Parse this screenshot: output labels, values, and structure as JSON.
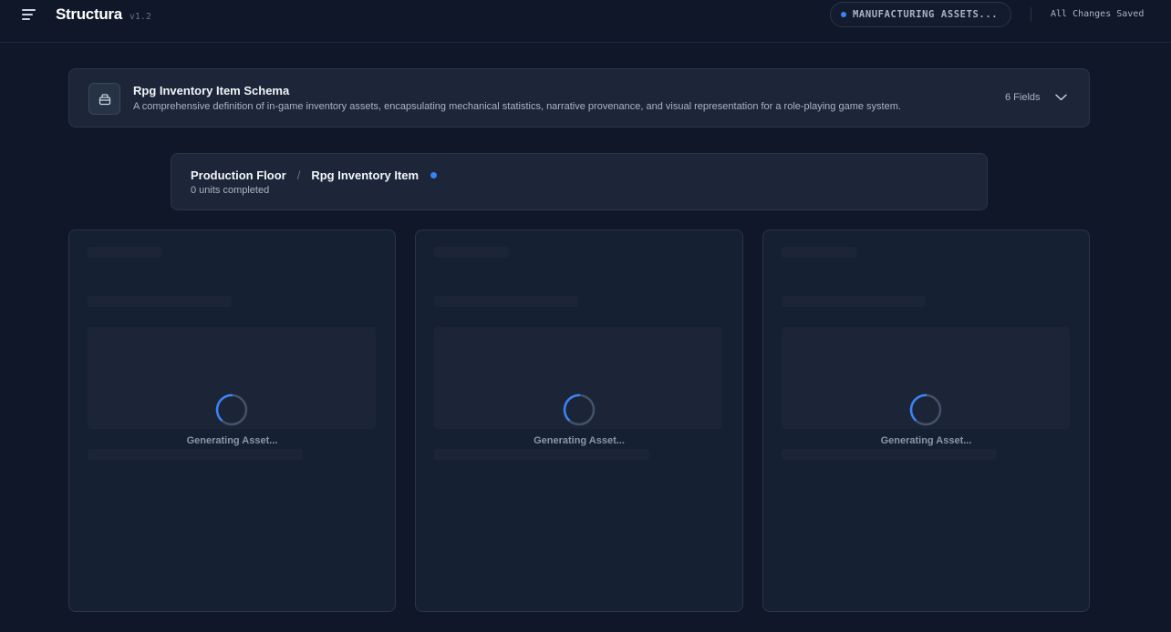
{
  "header": {
    "brand": "Structura",
    "version": "v1.2",
    "context": "MANUFACTURING ASSETS...",
    "save_status": "All Changes Saved"
  },
  "schema": {
    "title": "Rpg Inventory Item Schema",
    "description": "A comprehensive definition of in-game inventory assets, encapsulating mechanical statistics, narrative provenance, and visual representation for a role-playing game system.",
    "fields": "6 Fields",
    "icon": "package-icon"
  },
  "production": {
    "crumbs": [
      "Production Floor",
      "Rpg Inventory Item"
    ],
    "separator": "/",
    "units": "0 units completed"
  },
  "assets": [
    {
      "status": "Generating Asset..."
    },
    {
      "status": "Generating Asset..."
    },
    {
      "status": "Generating Asset..."
    }
  ],
  "colors": {
    "background": "#0f1729",
    "card": "#1c2638",
    "accent": "#3b82f6"
  }
}
